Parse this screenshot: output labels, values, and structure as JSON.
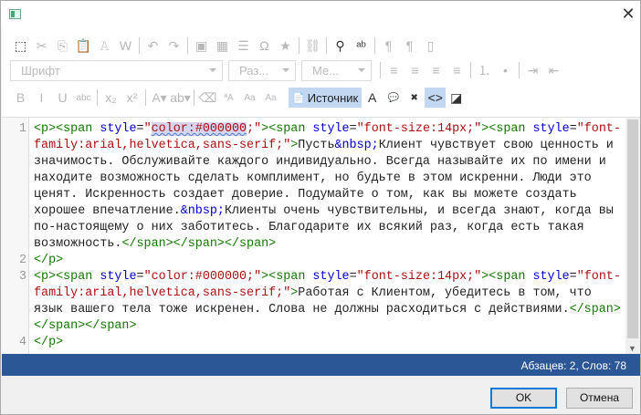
{
  "window": {
    "close_icon": "close-icon"
  },
  "toolbar": {
    "row1": [
      {
        "icon": "select-all-icon",
        "on": true
      },
      {
        "icon": "cut-icon"
      },
      {
        "icon": "copy-icon"
      },
      {
        "icon": "paste-icon"
      },
      {
        "icon": "paste-text-icon"
      },
      {
        "icon": "paste-word-icon"
      },
      {
        "sep": true
      },
      {
        "icon": "undo-icon"
      },
      {
        "icon": "redo-icon"
      },
      {
        "sep": true
      },
      {
        "icon": "image-icon"
      },
      {
        "icon": "table-icon"
      },
      {
        "icon": "horizontal-line-icon"
      },
      {
        "icon": "special-char-icon"
      },
      {
        "icon": "star-icon"
      },
      {
        "sep": true
      },
      {
        "icon": "unlink-icon"
      },
      {
        "sep": true
      },
      {
        "icon": "find-icon",
        "on": true
      },
      {
        "icon": "replace-icon",
        "on": true
      },
      {
        "sep": true
      },
      {
        "icon": "ltr-icon"
      },
      {
        "icon": "rtl-icon"
      },
      {
        "icon": "iframe-icon"
      }
    ],
    "font_placeholder": "Шрифт",
    "size_placeholder": "Раз...",
    "format_placeholder": "Ме...",
    "row2": [
      {
        "icon": "align-left-icon"
      },
      {
        "icon": "align-center-icon"
      },
      {
        "icon": "align-right-icon"
      },
      {
        "icon": "align-justify-icon"
      },
      {
        "sep": true
      },
      {
        "icon": "numbered-list-icon"
      },
      {
        "icon": "bullet-list-icon"
      },
      {
        "sep": true
      },
      {
        "icon": "indent-icon"
      },
      {
        "icon": "outdent-icon"
      }
    ],
    "row3": [
      {
        "icon": "bold-icon"
      },
      {
        "icon": "italic-icon"
      },
      {
        "icon": "underline-icon"
      },
      {
        "icon": "strikethrough-icon"
      },
      {
        "sep": true
      },
      {
        "icon": "subscript-icon"
      },
      {
        "icon": "superscript-icon"
      },
      {
        "sep": true
      },
      {
        "icon": "text-color-icon"
      },
      {
        "icon": "bg-color-icon"
      },
      {
        "sep": true
      },
      {
        "icon": "eraser-icon"
      },
      {
        "icon": "lowercase-icon"
      },
      {
        "icon": "uppercase-icon"
      },
      {
        "icon": "capitalize-icon"
      }
    ],
    "source_label": "Источник",
    "row3b": [
      {
        "icon": "show-blocks-icon",
        "on": true
      },
      {
        "icon": "add-comment-icon",
        "on": true
      },
      {
        "icon": "delete-comment-icon",
        "on": true
      },
      {
        "icon": "code-icon",
        "on": true,
        "act": true
      },
      {
        "icon": "contrast-icon",
        "on": true
      }
    ]
  },
  "editor": {
    "lines": [
      {
        "n": "1",
        "tokens": [
          [
            "tag",
            "<p><span "
          ],
          [
            "attr",
            "style"
          ],
          [
            "txt",
            "="
          ],
          [
            "str",
            "\""
          ],
          [
            "sel",
            "color:#000000"
          ],
          [
            "str",
            ";\""
          ],
          [
            "tag",
            "><span "
          ],
          [
            "attr",
            "style"
          ],
          [
            "txt",
            "="
          ],
          [
            "str",
            "\"font-size:14px;\""
          ],
          [
            "tag",
            "><span "
          ],
          [
            "attr",
            "style"
          ],
          [
            "txt",
            "="
          ],
          [
            "str",
            "\"font-family:arial,helvetica,sans-serif;\""
          ],
          [
            "tag",
            ">"
          ],
          [
            "txt",
            "Пусть"
          ],
          [
            "ent",
            "&nbsp;"
          ],
          [
            "txt",
            "Клиент чувствует свою ценность и значимость. Обслуживайте каждого индивидуально. Всегда называйте их по имени и находите возможность сделать комплимент, но будьте в этом искренни. Люди это ценят. Искренность создает доверие. Подумайте о том, как вы можете создать хорошее впечатление."
          ],
          [
            "ent",
            "&nbsp;"
          ],
          [
            "txt",
            "Клиенты очень чувствительны, и всегда знают, когда вы по-настоящему о них заботитесь. Благодарите их всякий раз, когда есть такая возможность."
          ],
          [
            "tag",
            "</span></span></span>"
          ]
        ]
      },
      {
        "n": "2",
        "tokens": [
          [
            "tag",
            "</p>"
          ]
        ]
      },
      {
        "n": "3",
        "tokens": [
          [
            "tag",
            "<p><span "
          ],
          [
            "attr",
            "style"
          ],
          [
            "txt",
            "="
          ],
          [
            "str",
            "\"color:#000000;\""
          ],
          [
            "tag",
            "><span "
          ],
          [
            "attr",
            "style"
          ],
          [
            "txt",
            "="
          ],
          [
            "str",
            "\"font-size:14px;\""
          ],
          [
            "tag",
            "><span "
          ],
          [
            "attr",
            "style"
          ],
          [
            "txt",
            "="
          ],
          [
            "str",
            "\"font-family:arial,helvetica,sans-serif;\""
          ],
          [
            "tag",
            ">"
          ],
          [
            "txt",
            "Работая с Клиентом, убедитесь в том, что язык вашего тела тоже искренен. Слова не должны расходиться с действиями."
          ],
          [
            "tag",
            "</span></span></span>"
          ]
        ]
      },
      {
        "n": "4",
        "tokens": [
          [
            "tag",
            "</p>"
          ]
        ]
      }
    ]
  },
  "status": "Абзацев: 2, Слов: 78",
  "buttons": {
    "ok": "OK",
    "cancel": "Отмена"
  },
  "colors": {
    "status_bar": "#2b5797",
    "tag": "#117700",
    "attribute": "#0000cc",
    "string": "#aa1111"
  }
}
